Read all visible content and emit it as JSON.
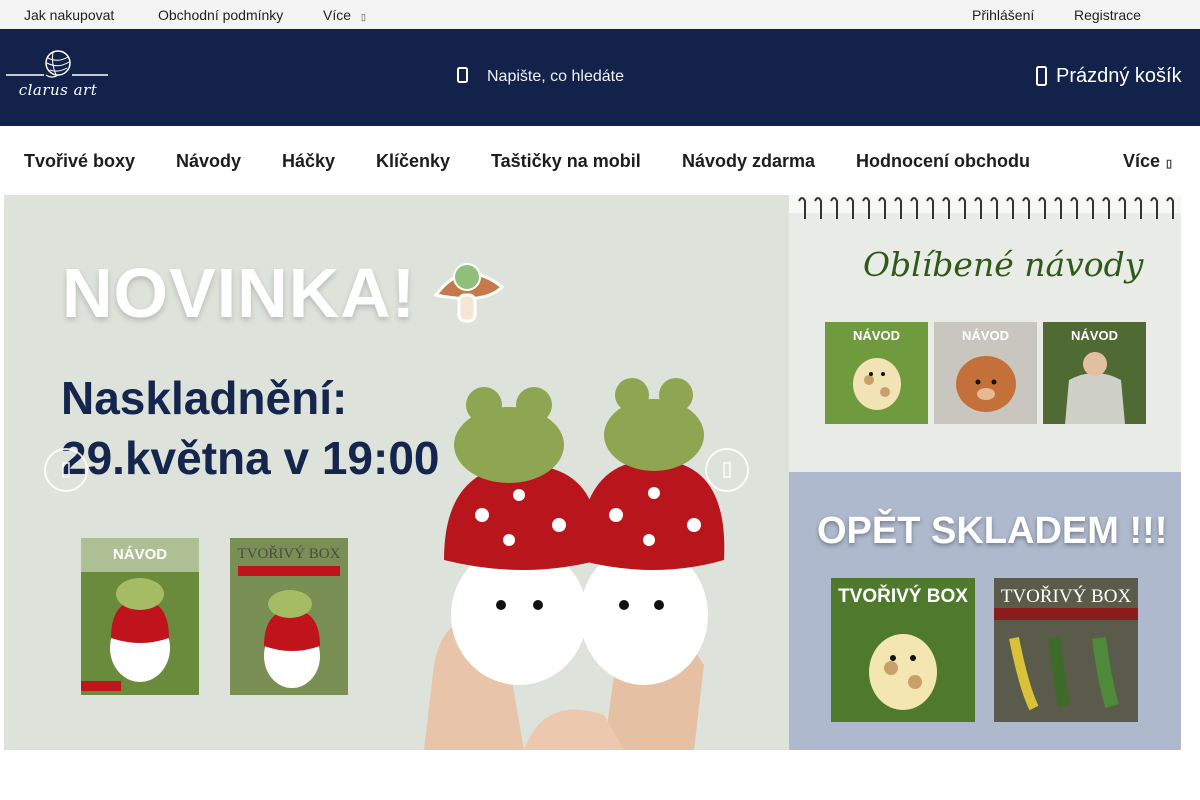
{
  "topbar": {
    "links": [
      "Jak nakupovat",
      "Obchodní podmínky",
      "Více"
    ],
    "more_caret": "▯",
    "login": "Přihlášení",
    "register": "Registrace"
  },
  "header": {
    "logo_text": "clarus art",
    "search_placeholder": "Napište, co hledáte",
    "cart_label": "Prázdný košík"
  },
  "nav": {
    "items": [
      "Tvořivé boxy",
      "Návody",
      "Háčky",
      "Klíčenky",
      "Taštičky na mobil",
      "Návody zdarma",
      "Hodnocení obchodu"
    ],
    "more": "Více",
    "more_caret": "▯"
  },
  "hero": {
    "title": "NOVINKA!",
    "subtitle_line1": "Naskladnění:",
    "subtitle_line2": "29.května v 19:00",
    "card_navod": "NÁVOD",
    "card_box": "TVOŘIVÝ BOX"
  },
  "banner_top": {
    "title": "Oblíbené návody",
    "thumb_labels": [
      "NÁVOD",
      "NÁVOD",
      "NÁVOD"
    ]
  },
  "banner_bottom": {
    "title": "OPĚT SKLADEM !!!",
    "box_labels": [
      "TVOŘIVÝ BOX",
      "TVOŘIVÝ BOX"
    ]
  },
  "colors": {
    "header_bg": "#13224a",
    "topbar_bg": "#f3f3f3",
    "hero_bg": "#dde3da",
    "hero_text": "#14264d",
    "banner_top_title": "#2d5a18",
    "banner_bottom_bg": "#aeb9cd"
  }
}
